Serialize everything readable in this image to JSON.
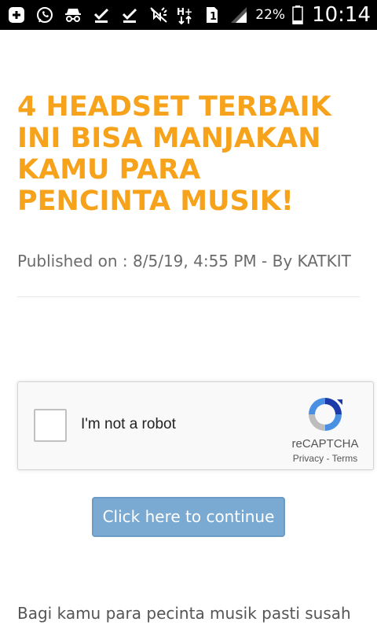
{
  "status_bar": {
    "battery_percent": "22%",
    "time": "10:14",
    "sim_slot": "1",
    "icons_left": [
      "add-box-icon",
      "whatsapp-icon",
      "incognito-icon",
      "download-done-icon",
      "download-done-icon"
    ],
    "icons_right": [
      "mute-icon",
      "data-hplus-icon",
      "sim-icon",
      "signal-icon",
      "battery-icon"
    ]
  },
  "article": {
    "title": "4 HEADSET TERBAIK INI BISA MANJAKAN KAMU PARA PENCINTA MUSIK!",
    "meta": "Published on : 8/5/19, 4:55 PM - By KATKIT",
    "body_start": "Bagi kamu para pecinta musik pasti susah"
  },
  "recaptcha": {
    "label": "I'm not a robot",
    "brand": "reCAPTCHA",
    "privacy": "Privacy",
    "separator": " - ",
    "terms": "Terms"
  },
  "continue_button": {
    "label": "Click here to continue"
  },
  "colors": {
    "title": "#f7a21b",
    "button_bg": "#7aa9d2",
    "status_bar_bg": "#000000"
  }
}
